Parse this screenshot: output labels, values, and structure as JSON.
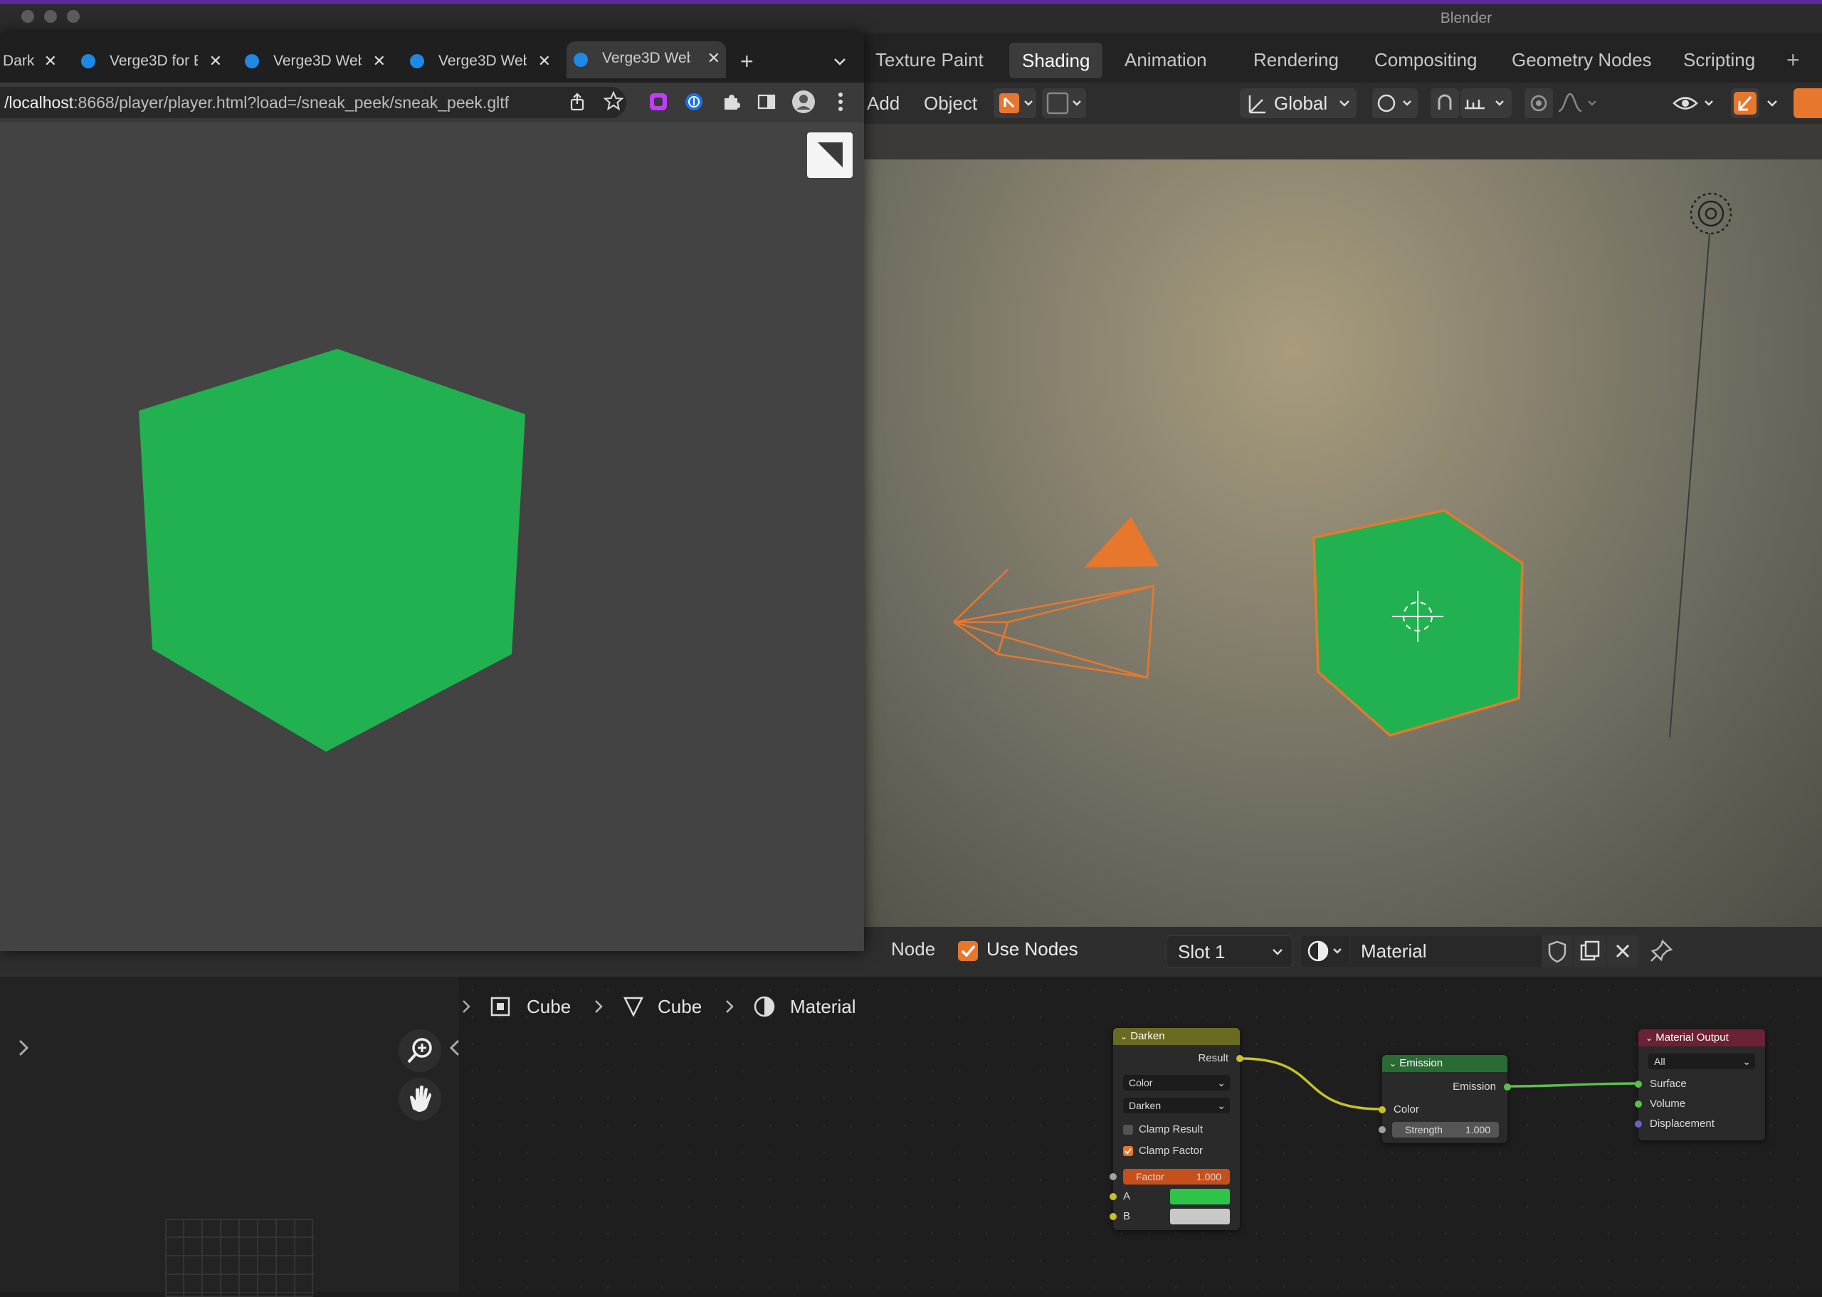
{
  "blender": {
    "window_title": "Blender",
    "workspace_tabs": [
      "Texture Paint",
      "Shading",
      "Animation",
      "Rendering",
      "Compositing",
      "Geometry Nodes",
      "Scripting"
    ],
    "active_tab": "Shading",
    "add_workspace": "+",
    "header": {
      "add_label": "Add",
      "object_label": "Object",
      "transform_orientation": "Global"
    },
    "node_header": {
      "node_label": "Node",
      "use_nodes_label": "Use Nodes",
      "use_nodes_checked": true,
      "slot_label": "Slot 1",
      "material_name": "Material"
    },
    "breadcrumb": [
      "Cube",
      "Cube",
      "Material"
    ],
    "nodes": {
      "darken": {
        "title": "Darken",
        "output": "Result",
        "data_type": "Color",
        "blend_type": "Darken",
        "clamp_result_label": "Clamp Result",
        "clamp_result_checked": false,
        "clamp_factor_label": "Clamp Factor",
        "clamp_factor_checked": true,
        "factor_label": "Factor",
        "factor_value": "1.000",
        "input_a": "A",
        "input_b": "B",
        "color_a": "#2ec44a",
        "color_b": "#c8c8c8"
      },
      "emission": {
        "title": "Emission",
        "output": "Emission",
        "color_input": "Color",
        "strength_label": "Strength",
        "strength_value": "1.000"
      },
      "output": {
        "title": "Material Output",
        "target": "All",
        "inputs": [
          "Surface",
          "Volume",
          "Displacement"
        ]
      }
    },
    "colors": {
      "accent_orange": "#e8772e",
      "cube_green": "#22b150"
    }
  },
  "browser": {
    "tabs": [
      {
        "label": "Dark",
        "active": false
      },
      {
        "label": "Verge3D for Bl",
        "active": false
      },
      {
        "label": "Verge3D Web",
        "active": false
      },
      {
        "label": "Verge3D Web",
        "active": false
      },
      {
        "label": "Verge3D Web",
        "active": true
      }
    ],
    "new_tab": "+",
    "url_host": "/localhost",
    "url_rest": ":8668/player/player.html?load=/sneak_peek/sneak_peek.gltf",
    "cube_color": "#22b150",
    "page_bg": "#434343"
  }
}
